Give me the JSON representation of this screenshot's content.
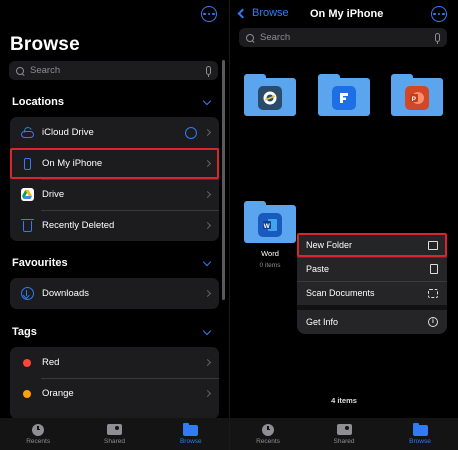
{
  "left": {
    "title": "Browse",
    "search_placeholder": "Search",
    "locations": {
      "header": "Locations",
      "items": [
        {
          "label": "iCloud Drive"
        },
        {
          "label": "On My iPhone"
        },
        {
          "label": "Drive"
        },
        {
          "label": "Recently Deleted"
        }
      ]
    },
    "favourites": {
      "header": "Favourites",
      "items": [
        {
          "label": "Downloads"
        }
      ]
    },
    "tags": {
      "header": "Tags",
      "items": [
        {
          "label": "Red",
          "color": "#ff453a"
        },
        {
          "label": "Orange",
          "color": "#ff9f0a"
        }
      ]
    },
    "tabs": [
      {
        "label": "Recents"
      },
      {
        "label": "Shared"
      },
      {
        "label": "Browse"
      }
    ]
  },
  "right": {
    "back_label": "Browse",
    "title": "On My iPhone",
    "search_placeholder": "Search",
    "folders": [
      {
        "app_icon": "ibis-paint-icon",
        "app_color": "#2b4b6b"
      },
      {
        "app_icon": "wps-office-icon",
        "app_color": "#1e6fe6"
      },
      {
        "app_icon": "powerpoint-icon",
        "app_color": "#d24726"
      },
      {
        "label": "Word",
        "sub": "0 items",
        "app_icon": "word-icon",
        "app_color": "#185abd"
      }
    ],
    "context_menu": [
      {
        "label": "New Folder",
        "icon": "new-folder-icon"
      },
      {
        "label": "Paste",
        "icon": "paste-icon"
      },
      {
        "label": "Scan Documents",
        "icon": "scan-icon"
      },
      {
        "label": "Get Info",
        "icon": "info-icon"
      }
    ],
    "item_count": "4 items",
    "tabs": [
      {
        "label": "Recents"
      },
      {
        "label": "Shared"
      },
      {
        "label": "Browse"
      }
    ]
  },
  "colors": {
    "accent": "#2f7cf6",
    "highlight_box": "#d9252c",
    "folder": "#5aa5ee"
  }
}
